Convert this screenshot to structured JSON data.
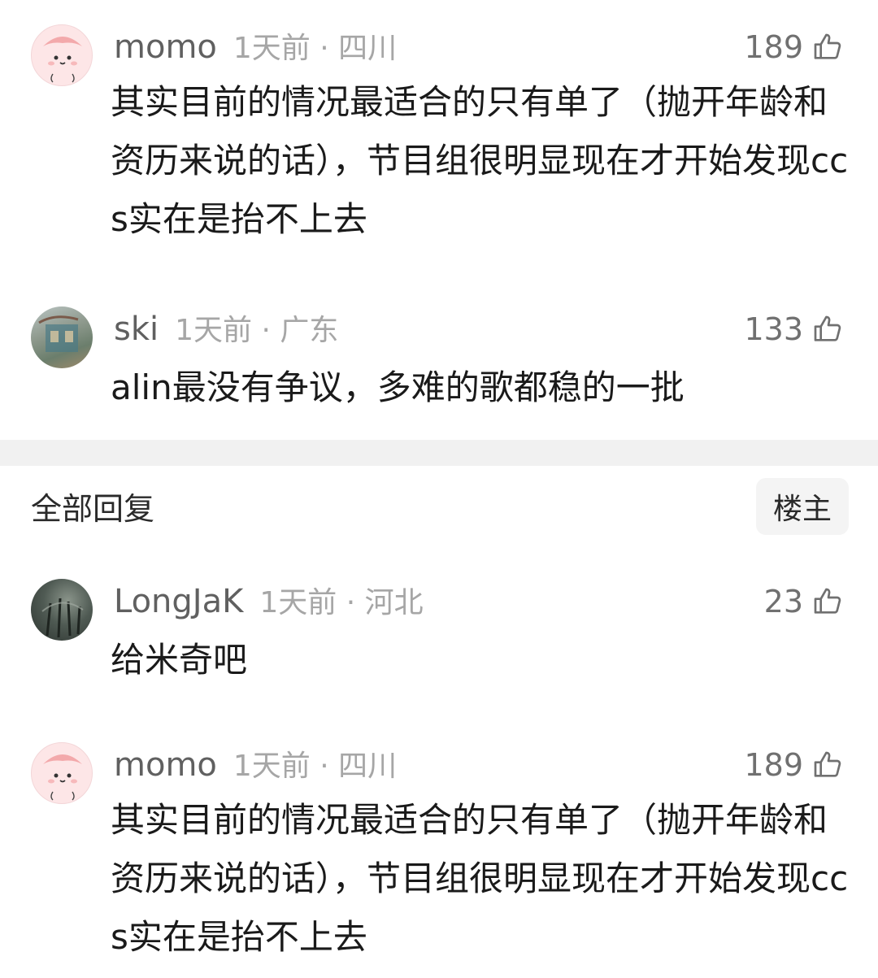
{
  "comments_top": [
    {
      "username": "momo",
      "time": "1天前",
      "location": "四川",
      "likes": "189",
      "avatar": "momo-avatar",
      "text": "其实目前的情况最适合的只有单了（抛开年龄和资历来说的话），节目组很明显现在才开始发现ccs实在是抬不上去"
    },
    {
      "username": "ski",
      "time": "1天前",
      "location": "广东",
      "likes": "133",
      "avatar": "ski-avatar",
      "text": "alin最没有争议，多难的歌都稳的一批"
    }
  ],
  "replies_header": {
    "title": "全部回复",
    "owner_button": "楼主"
  },
  "replies": [
    {
      "username": "LongJaK",
      "time": "1天前",
      "location": "河北",
      "likes": "23",
      "avatar": "longjak-avatar",
      "text": "给米奇吧"
    },
    {
      "username": "momo",
      "time": "1天前",
      "location": "四川",
      "likes": "189",
      "avatar": "momo-avatar",
      "text": "其实目前的情况最适合的只有单了（抛开年龄和资历来说的话），节目组很明显现在才开始发现ccs实在是抬不上去"
    }
  ],
  "separator": "·",
  "icons": {
    "like": "thumbs-up-icon"
  },
  "colors": {
    "username": "#606060",
    "meta": "#a6a6a6",
    "text": "#1a1a1a",
    "divider": "#f1f1f1",
    "avatar_pink": "#fde6e7"
  }
}
